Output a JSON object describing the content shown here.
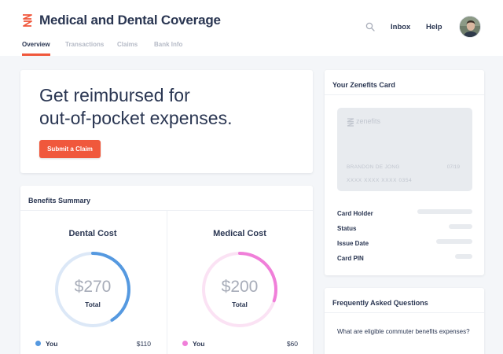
{
  "app": {
    "title": "Medical and Dental Coverage",
    "brand_color": "#f0583c",
    "logo_icon": "zenefits-logo-icon"
  },
  "tabs": [
    {
      "label": "Overview",
      "active": true
    },
    {
      "label": "Transactions",
      "active": false
    },
    {
      "label": "Claims",
      "active": false
    },
    {
      "label": "Bank Info",
      "active": false
    }
  ],
  "nav": {
    "search_icon": "search-icon",
    "inbox_label": "Inbox",
    "help_label": "Help",
    "avatar_icon": "user-avatar"
  },
  "hero": {
    "title_line1": "Get reimbursed for",
    "title_line2": "out-of-pocket expenses.",
    "button_label": "Submit a Claim"
  },
  "benefits": {
    "title": "Benefits Summary",
    "dental": {
      "title": "Dental Cost",
      "amount": "$270",
      "total_label": "Total",
      "color": "#5599e0",
      "track_color": "#dce8f7",
      "used_fraction": 0.41,
      "legend_label": "You",
      "legend_value": "$110"
    },
    "medical": {
      "title": "Medical Cost",
      "amount": "$200",
      "total_label": "Total",
      "color": "#f07fd9",
      "track_color": "#fbe2f4",
      "used_fraction": 0.3,
      "legend_label": "You",
      "legend_value": "$60"
    }
  },
  "zenefits_card": {
    "title": "Your Zenefits Card",
    "brand": "zenefits",
    "holder_name": "BRANDON DE JONG",
    "expiry": "07/19",
    "number": "XXXX XXXX XXXX 0354",
    "fields": [
      {
        "label": "Card Holder"
      },
      {
        "label": "Status"
      },
      {
        "label": "Issue Date"
      },
      {
        "label": "Card PIN"
      }
    ]
  },
  "faq": {
    "title": "Frequently Asked Questions",
    "question": "What are eligible commuter benefits expenses?"
  }
}
